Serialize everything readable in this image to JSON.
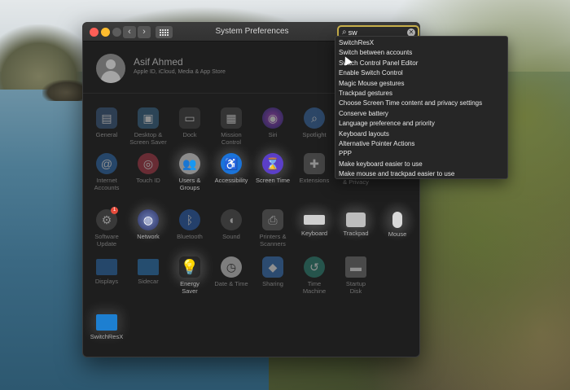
{
  "window": {
    "title": "System Preferences"
  },
  "search": {
    "value": "sw",
    "clear_icon": "clear-icon"
  },
  "user": {
    "name": "Asif  Ahmed",
    "subtitle": "Apple ID, iCloud, Media & App Store"
  },
  "panes": {
    "general": {
      "l1": "General",
      "l2": ""
    },
    "desktop": {
      "l1": "Desktop &",
      "l2": "Screen Saver"
    },
    "dock": {
      "l1": "Dock",
      "l2": ""
    },
    "mission": {
      "l1": "Mission",
      "l2": "Control"
    },
    "siri": {
      "l1": "Siri",
      "l2": ""
    },
    "spotlight": {
      "l1": "Spotlight",
      "l2": ""
    },
    "internet": {
      "l1": "Internet",
      "l2": "Accounts"
    },
    "touchid": {
      "l1": "Touch ID",
      "l2": ""
    },
    "users": {
      "l1": "Users &",
      "l2": "Groups"
    },
    "accessibility": {
      "l1": "Accessibility",
      "l2": ""
    },
    "screentime": {
      "l1": "Screen Time",
      "l2": ""
    },
    "extensions": {
      "l1": "Extensions",
      "l2": ""
    },
    "privacy": {
      "l1": "& Privacy",
      "l2": ""
    },
    "software": {
      "l1": "Software",
      "l2": "Update",
      "badge": "1"
    },
    "network": {
      "l1": "Network",
      "l2": ""
    },
    "bluetooth": {
      "l1": "Bluetooth",
      "l2": ""
    },
    "sound": {
      "l1": "Sound",
      "l2": ""
    },
    "printers": {
      "l1": "Printers &",
      "l2": "Scanners"
    },
    "keyboard": {
      "l1": "Keyboard",
      "l2": ""
    },
    "trackpad": {
      "l1": "Trackpad",
      "l2": ""
    },
    "mouse": {
      "l1": "Mouse",
      "l2": ""
    },
    "displays": {
      "l1": "Displays",
      "l2": ""
    },
    "sidecar": {
      "l1": "Sidecar",
      "l2": ""
    },
    "energy": {
      "l1": "Energy",
      "l2": "Saver"
    },
    "datetime": {
      "l1": "Date & Time",
      "l2": ""
    },
    "sharing": {
      "l1": "Sharing",
      "l2": ""
    },
    "timemachine": {
      "l1": "Time",
      "l2": "Machine"
    },
    "startup": {
      "l1": "Startup",
      "l2": "Disk"
    },
    "switchresx": {
      "l1": "SwitchResX",
      "l2": ""
    }
  },
  "suggestions": [
    "SwitchResX",
    "Switch between accounts",
    "Switch Control Panel Editor",
    "Enable Switch Control",
    "Magic Mouse gestures",
    "Trackpad gestures",
    "Choose Screen Time content and privacy settings",
    "Conserve battery",
    "Language preference and priority",
    "Keyboard layouts",
    "Alternative Pointer Actions",
    "PPP",
    "Make keyboard easier to use",
    "Make mouse and trackpad easier to use"
  ],
  "colors": {
    "search_ring": "#c9b04a",
    "window_bg": "#1e1e1e",
    "close": "#fe5f57",
    "minimize": "#febc2e"
  }
}
